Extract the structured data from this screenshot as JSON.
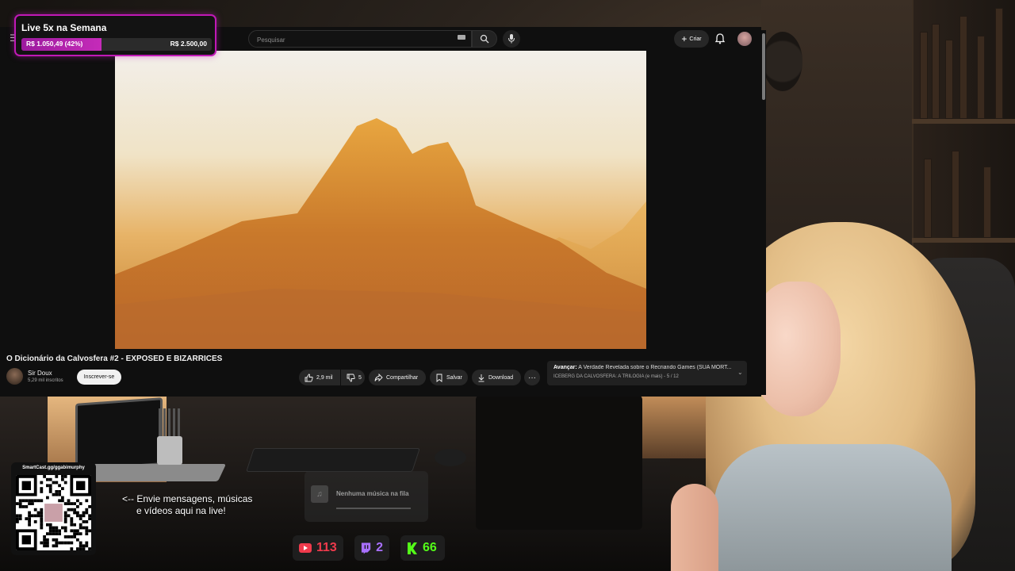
{
  "goal_widget": {
    "title": "Live 5x na Semana",
    "current": "R$ 1.050,49 (42%)",
    "target": "R$ 2.500,00",
    "progress_fraction": 0.42,
    "accent_color": "#c019b6"
  },
  "youtube": {
    "search_placeholder": "Pesquisar",
    "create_label": "Criar",
    "video_title": "O Dicionário da Calvosfera #2 - EXPOSED E BIZARRICES",
    "channel_name": "Sir Doux",
    "channel_subs": "5,29 mil inscritos",
    "subscribe_label": "Inscrever-se",
    "like_count": "2,9 mil",
    "dislike_count": "5",
    "share_label": "Compartilhar",
    "save_label": "Salvar",
    "download_label": "Download",
    "more_label": "···",
    "playlist": {
      "prefix": "Avançar:",
      "next_title": "A Verdade Revelada sobre o Recriando Games (SUA MORT...",
      "name": "ICEBERG DA CALVOSFERA: A TRILOGIA (e mais)",
      "position": "5 / 12"
    }
  },
  "overlay": {
    "qr_caption": "SmartCast.gg/ggabimurphy",
    "promo_line1": "<-- Envie mensagens, músicas",
    "promo_line2": "e vídeos aqui na live!",
    "music_status": "Nenhuma música na fila",
    "viewers": {
      "youtube": "113",
      "twitch": "2",
      "kick": "66"
    },
    "colors": {
      "youtube": "#f03a4c",
      "twitch": "#a970ff",
      "kick": "#53fc18"
    }
  }
}
